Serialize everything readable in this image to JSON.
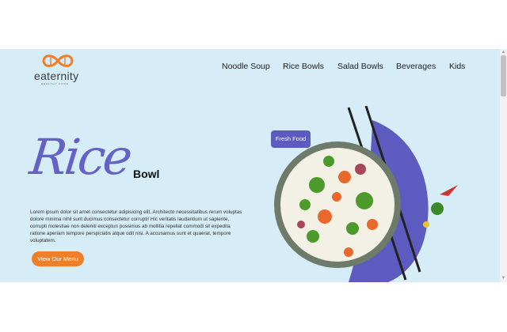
{
  "brand": {
    "name": "eaternity",
    "tagline": "HEALTHY FOOD",
    "accent": "#f07f2a"
  },
  "nav": {
    "items": [
      {
        "label": "Noodle Soup"
      },
      {
        "label": "Rice Bowls"
      },
      {
        "label": "Salad Bowls"
      },
      {
        "label": "Beverages"
      },
      {
        "label": "Kids"
      }
    ]
  },
  "hero": {
    "script_title": "Rice",
    "subtitle": "Bowl",
    "description": "Lorem ipsum dolor sit amet consectetur adipisicing elit. Architecto necessitatibus rerum voluptas dolore minima nihil sunt ducimus consectetur corrupti! Hic veritatis laudantium ut sapiente, corrupti molestiae non deleniti excepturi possimus ab mollitia repellat commodi sit expedita ratione aperiam tempore perspiciatis atque odit nisi. A accusamus sunt et quaerat, tempore voluptatem.",
    "cta_label": "View Our Menu",
    "badge_label": "Fresh Food",
    "script_color": "#6562c7",
    "badge_color": "#5d5bbf"
  },
  "page": {
    "background": "#d6ecf6"
  }
}
